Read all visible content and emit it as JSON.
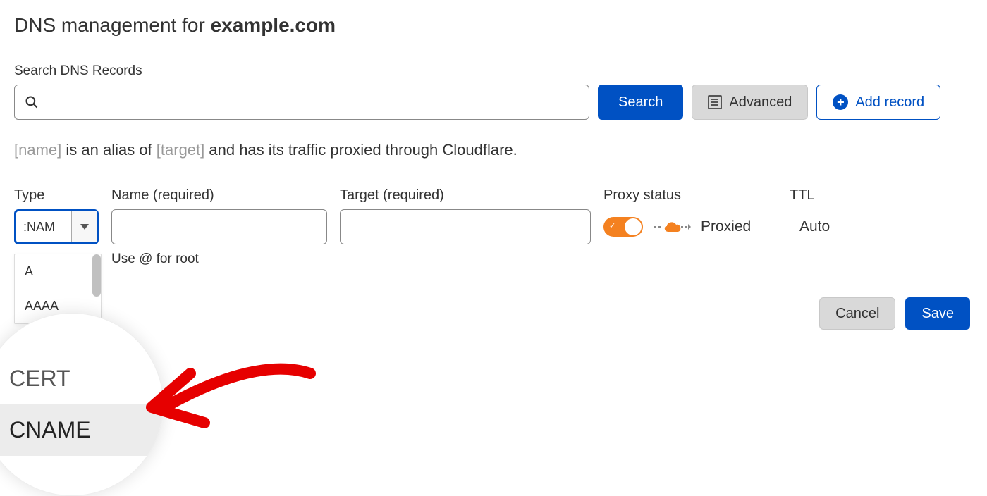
{
  "title": {
    "prefix": "DNS management for ",
    "domain": "example.com"
  },
  "search": {
    "label": "Search DNS Records",
    "button": "Search",
    "advanced": "Advanced",
    "add_record": "Add record"
  },
  "description": {
    "name_placeholder": "[name]",
    "middle1": " is an alias of ",
    "target_placeholder": "[target]",
    "middle2": " and has its traffic proxied through Cloudflare."
  },
  "form": {
    "type_label": "Type",
    "type_value": ":NAM",
    "name_label": "Name (required)",
    "name_hint": "Use @ for root",
    "target_label": "Target (required)",
    "proxy_label": "Proxy status",
    "proxy_value": "Proxied",
    "ttl_label": "TTL",
    "ttl_value": "Auto"
  },
  "dropdown": {
    "items": [
      "A",
      "AAAA"
    ]
  },
  "zoom": {
    "item1": "CERT",
    "item2": "CNAME"
  },
  "actions": {
    "cancel": "Cancel",
    "save": "Save"
  }
}
